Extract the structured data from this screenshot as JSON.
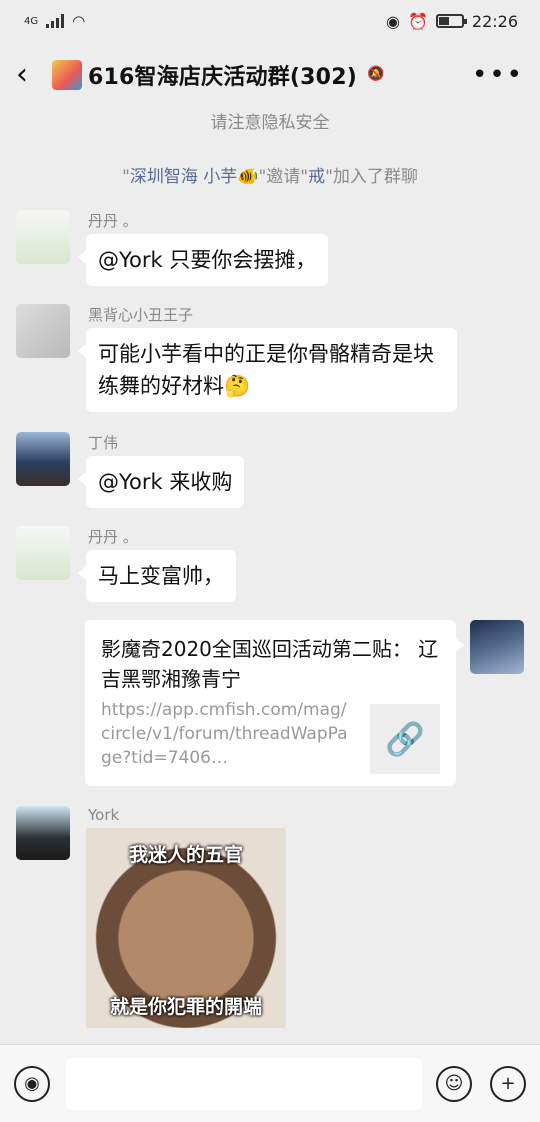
{
  "status": {
    "network": "4G",
    "time": "22:26"
  },
  "header": {
    "title": "616智海店庆活动群(302)"
  },
  "notices": {
    "privacy": "请注意隐私安全",
    "join_prefix": "\"",
    "join_inviter": "深圳智海 小芋🐠",
    "join_middle": "\"邀请\"",
    "join_invitee": "戒",
    "join_suffix": "\"加入了群聊"
  },
  "messages": [
    {
      "sender": "丹丹 。",
      "text": "@York  只要你会摆摊，"
    },
    {
      "sender": "黑背心小丑王子",
      "text": "可能小芋看中的正是你骨骼精奇是块练舞的好材料🤔"
    },
    {
      "sender": "丁伟",
      "text": "@York  来收购"
    },
    {
      "sender": "丹丹 。",
      "text": "马上变富帅，"
    }
  ],
  "link_card": {
    "title": "影魔奇2020全国巡回活动第二贴：  辽吉黑鄂湘豫青宁",
    "url": "https://app.cmfish.com/mag/circle/v1/forum/threadWapPage?tid=7406…",
    "icon": "link-icon"
  },
  "sticker_msg": {
    "sender": "York",
    "caption_top": "我迷人的五官",
    "caption_bottom": "就是你犯罪的開端"
  },
  "colors": {
    "accent": "#576b95",
    "background": "#ededed"
  }
}
